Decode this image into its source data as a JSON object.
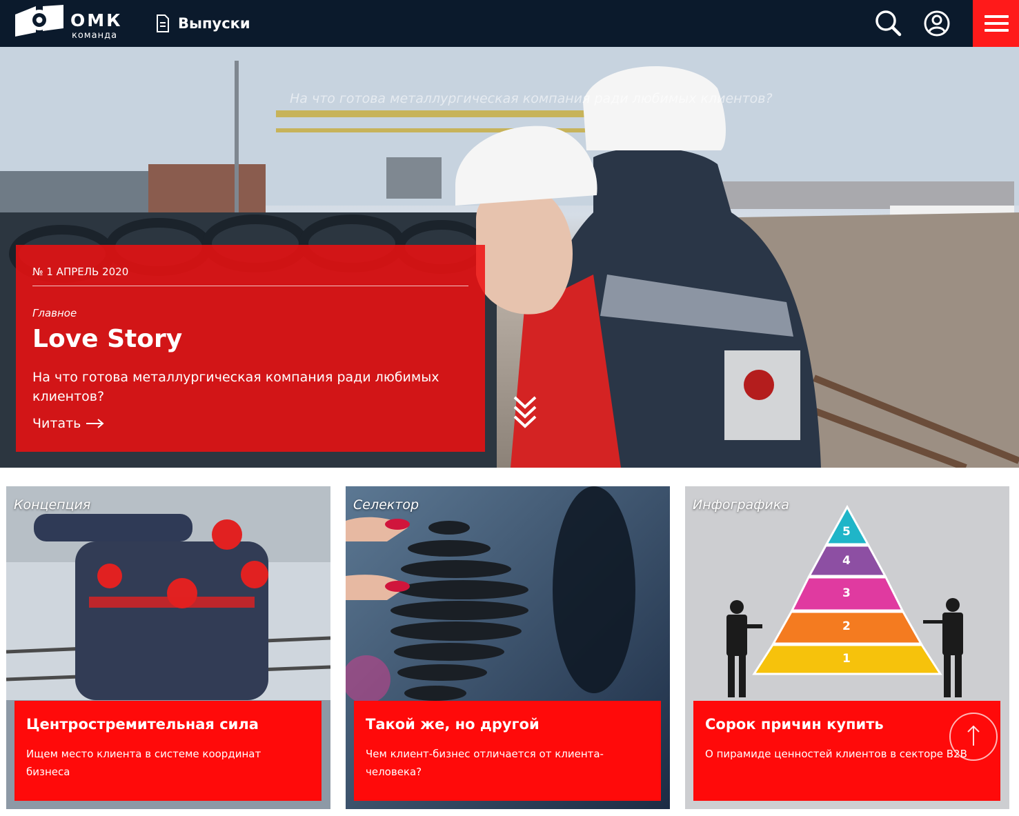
{
  "header": {
    "logo_title": "ОМК",
    "logo_subtitle": "команда",
    "issues_label": "Выпуски",
    "icons": {
      "issues": "document-icon",
      "search": "search-icon",
      "profile": "user-icon",
      "menu": "hamburger-icon"
    }
  },
  "hero": {
    "ghost_text": "На что готова металлургическая компания ради любимых клиентов?",
    "issue": "№ 1 АПРЕЛЬ 2020",
    "rubric": "Главное",
    "title": "Love Story",
    "lead": "На что готова металлургическая компания ради любимых клиентов?",
    "read_label": "Читать",
    "scroll_icon": "double-chevron-down-icon"
  },
  "cards": [
    {
      "rubric": "Концепция",
      "title": "Центростремительная сила",
      "text": "Ищем место клиента в системе координат бизнеса"
    },
    {
      "rubric": "Селектор",
      "title": "Такой же, но другой",
      "text": "Чем клиент-бизнес отличается от клиента-человека?"
    },
    {
      "rubric": "Инфографика",
      "title": "Сорок причин купить",
      "text": "О пирамиде ценностей клиентов в секторе B2B",
      "pyramid_levels": [
        "5",
        "4",
        "3",
        "2",
        "1"
      ]
    }
  ],
  "colors": {
    "header_bg": "#0b1a2c",
    "accent_red": "#ff0a0a",
    "menu_red": "#ff1a1a",
    "pyramid": [
      "#1fb5c8",
      "#8d4fa3",
      "#e03aa0",
      "#f47b20",
      "#f6c20c"
    ]
  },
  "to_top_icon": "arrow-up-icon"
}
